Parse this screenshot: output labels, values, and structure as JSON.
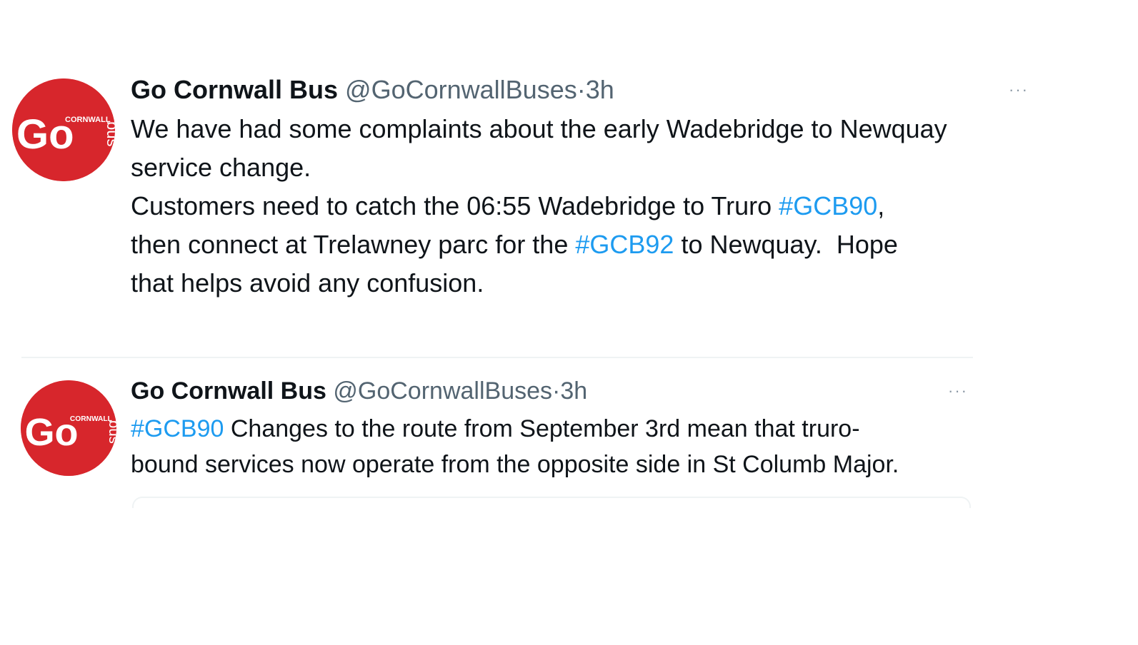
{
  "tweets": [
    {
      "author": {
        "display_name": "Go Cornwall Bus",
        "handle": "@GoCornwallBuses",
        "dot": "·",
        "time": "3h",
        "avatar_text": {
          "main": "Go",
          "top": "CORNWALL",
          "side": "bus"
        }
      },
      "more_label": "···",
      "text": {
        "line1": "We have had some complaints about the early Wadebridge to Newquay",
        "line2": "service change.",
        "line3_pre": "Customers need to catch the 06:55 Wadebridge to Truro ",
        "line3_tag": "#GCB90",
        "line3_post": ",",
        "line4_pre": "then connect at Trelawney parc for the ",
        "line4_tag": "#GCB92",
        "line4_post": " to Newquay.  Hope",
        "line5": "that helps avoid any confusion."
      }
    },
    {
      "author": {
        "display_name": "Go Cornwall Bus",
        "handle": "@GoCornwallBuses",
        "dot": "·",
        "time": "3h",
        "avatar_text": {
          "main": "Go",
          "top": "CORNWALL",
          "side": "bus"
        }
      },
      "more_label": "···",
      "text": {
        "line1_tag": "#GCB90",
        "line1_post": " Changes to the route from September 3rd mean that truro-",
        "line2": "bound services now operate from the opposite side in St Columb Major."
      }
    }
  ],
  "colors": {
    "brand_red": "#d7262c",
    "hashtag_blue": "#1d9bf0",
    "text_primary": "#0f1419",
    "text_secondary": "#536471"
  },
  "icons": {
    "more": "more-horizontal-icon",
    "avatar": "go-cornwall-bus-logo"
  }
}
